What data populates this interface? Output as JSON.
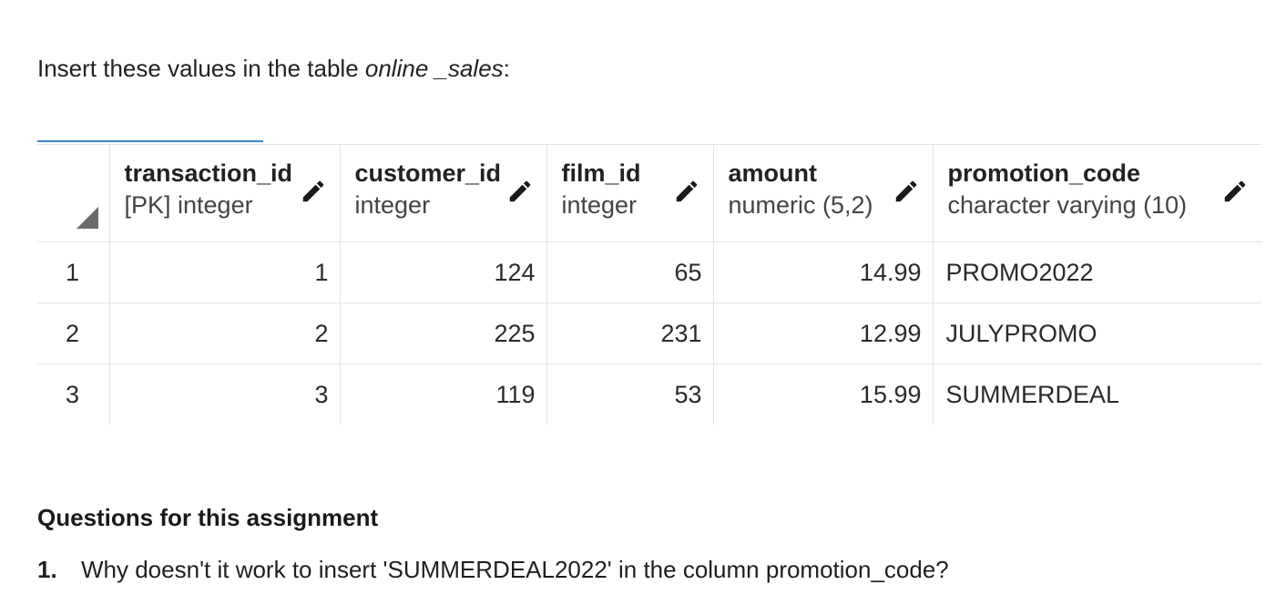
{
  "intro": {
    "text_before": "Insert these values in the table ",
    "table_name": "online _sales",
    "text_after": ":"
  },
  "grid": {
    "columns": [
      {
        "name": "transaction_id",
        "type": "[PK] integer"
      },
      {
        "name": "customer_id",
        "type": "integer"
      },
      {
        "name": "film_id",
        "type": "integer"
      },
      {
        "name": "amount",
        "type": "numeric (5,2)"
      },
      {
        "name": "promotion_code",
        "type": "character varying (10)"
      }
    ],
    "rows": [
      {
        "num": "1",
        "cells": [
          "1",
          "124",
          "65",
          "14.99",
          "PROMO2022"
        ]
      },
      {
        "num": "2",
        "cells": [
          "2",
          "225",
          "231",
          "12.99",
          "JULYPROMO"
        ]
      },
      {
        "num": "3",
        "cells": [
          "3",
          "119",
          "53",
          "15.99",
          "SUMMERDEAL"
        ]
      }
    ]
  },
  "questions": {
    "title": "Questions for this assignment",
    "items": [
      {
        "num": "1.",
        "text": "Why doesn't it work to insert 'SUMMERDEAL2022' in the column promotion_code?"
      }
    ]
  },
  "icons": {
    "edit_column": "pencil-icon",
    "row_header_corner": "corner-triangle-icon"
  },
  "colors": {
    "tab_accent": "#3f86c7",
    "grid_line": "#e3e3e3",
    "corner_marker": "#6b6b6b"
  }
}
